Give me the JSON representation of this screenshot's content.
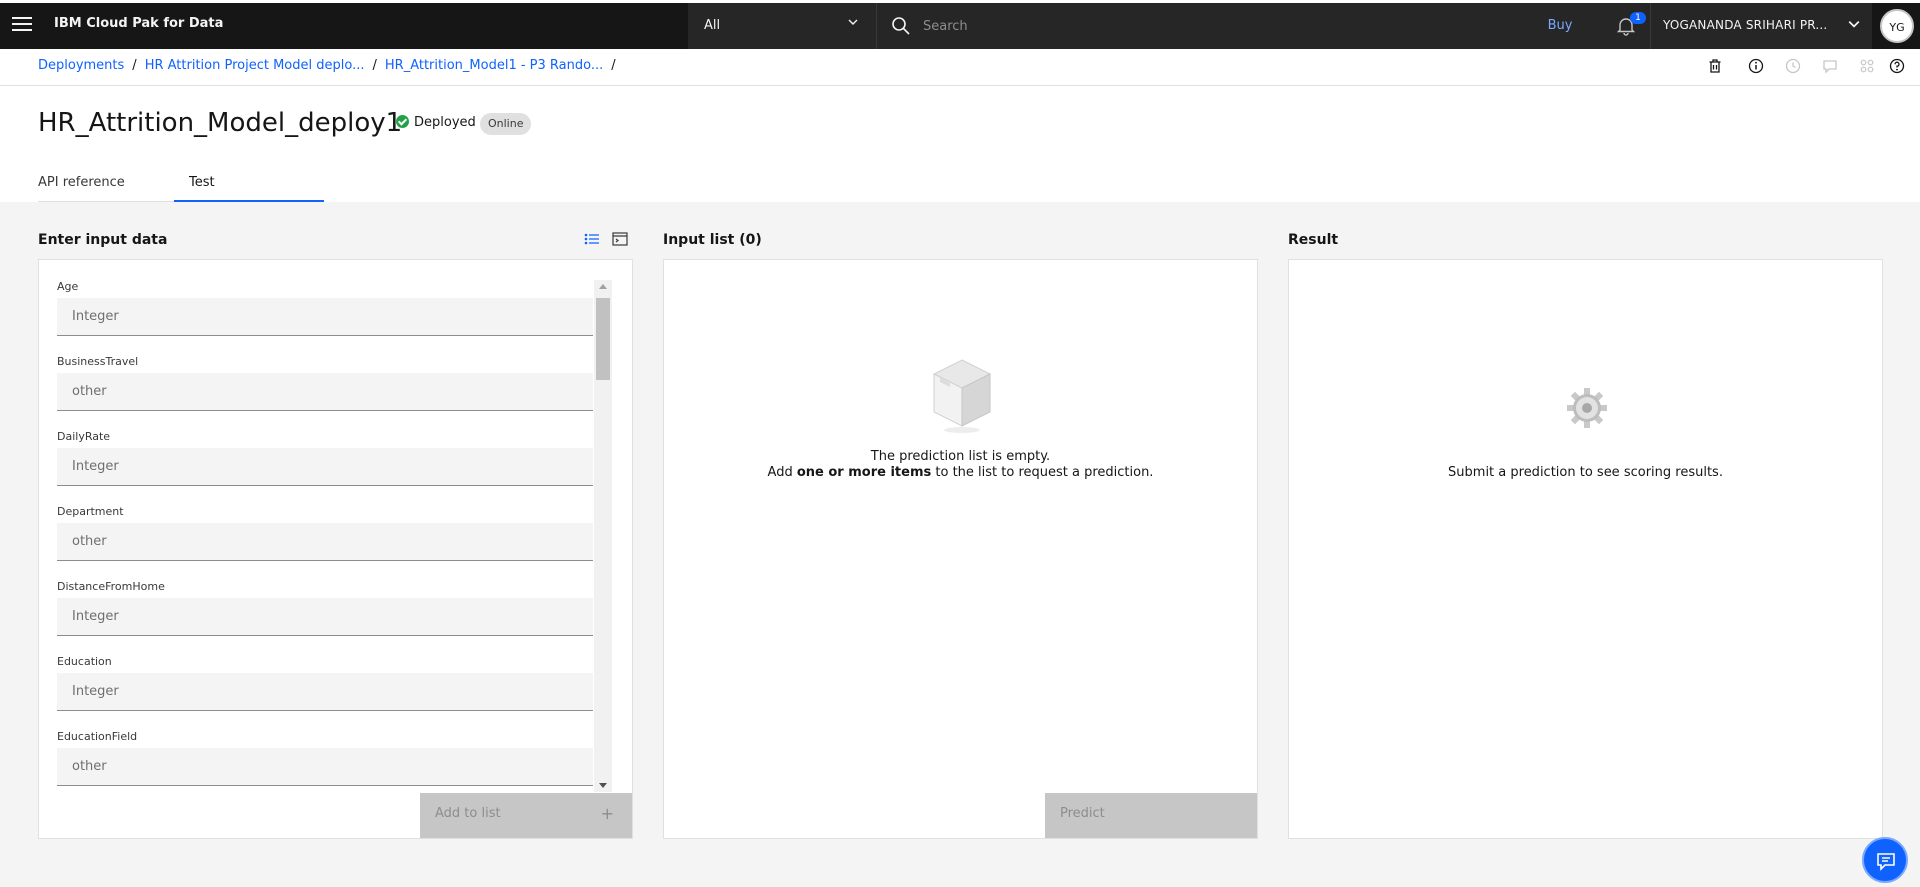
{
  "app": {
    "title": "IBM Cloud Pak for Data"
  },
  "header": {
    "scope_selected": "All",
    "search_placeholder": "Search",
    "buy_label": "Buy",
    "notification_count": "1",
    "user_name": "YOGANANDA SRIHARI PR...",
    "user_initials": "YG"
  },
  "breadcrumb": [
    {
      "label": "Deployments"
    },
    {
      "label": "HR Attrition Project Model deplo..."
    },
    {
      "label": "HR_Attrition_Model1 - P3 Rando..."
    }
  ],
  "breadcrumb_sep": "/",
  "page": {
    "title": "HR_Attrition_Model_deploy1",
    "status": "Deployed",
    "tag": "Online"
  },
  "tabs": [
    {
      "label": "API reference",
      "active": false
    },
    {
      "label": "Test",
      "active": true
    }
  ],
  "input_panel": {
    "title": "Enter input data",
    "fields": [
      {
        "label": "Age",
        "placeholder": "Integer"
      },
      {
        "label": "BusinessTravel",
        "placeholder": "other"
      },
      {
        "label": "DailyRate",
        "placeholder": "Integer"
      },
      {
        "label": "Department",
        "placeholder": "other"
      },
      {
        "label": "DistanceFromHome",
        "placeholder": "Integer"
      },
      {
        "label": "Education",
        "placeholder": "Integer"
      },
      {
        "label": "EducationField",
        "placeholder": "other"
      }
    ],
    "add_button": "Add to list",
    "add_button_icon": "+"
  },
  "input_list": {
    "title": "Input list (0)",
    "empty_line1": "The prediction list is empty.",
    "empty_line2_pre": "Add ",
    "empty_line2_bold": "one or more items",
    "empty_line2_post": " to the list to request a prediction.",
    "predict_button": "Predict"
  },
  "result": {
    "title": "Result",
    "empty_text": "Submit a prediction to see scoring results."
  },
  "colors": {
    "accent": "#0f62fe",
    "success": "#24a148",
    "topbar": "#161616"
  },
  "icons": [
    "menu-icon",
    "chevron-down-icon",
    "search-icon",
    "notification-icon",
    "trash-icon",
    "info-icon",
    "history-icon",
    "comment-icon",
    "apps-icon",
    "help-icon",
    "list-view-icon",
    "terminal-view-icon",
    "box-icon",
    "gear-icon",
    "chat-icon"
  ]
}
